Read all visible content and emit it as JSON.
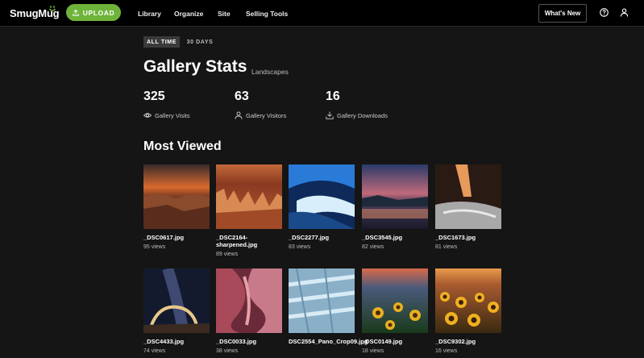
{
  "header": {
    "logo": "SmugMug",
    "upload_label": "UPLOAD",
    "nav": [
      "Library",
      "Organize",
      "Site",
      "Selling Tools"
    ],
    "whats_new": "What's New",
    "accent_color": "#6fb43a"
  },
  "range_tabs": [
    {
      "label": "ALL TIME",
      "active": true
    },
    {
      "label": "30 DAYS",
      "active": false
    }
  ],
  "page": {
    "title": "Gallery Stats",
    "gallery_name": "Landscapes"
  },
  "stats": [
    {
      "value": "325",
      "label": "Gallery Visits",
      "icon": "eye-icon"
    },
    {
      "value": "63",
      "label": "Gallery Visitors",
      "icon": "person-icon"
    },
    {
      "value": "16",
      "label": "Gallery Downloads",
      "icon": "download-icon"
    }
  ],
  "most_viewed": {
    "title": "Most Viewed",
    "items": [
      {
        "file": "_DSC0617.jpg",
        "views": "95 views"
      },
      {
        "file": "_DSC2164-sharpened.jpg",
        "views": "89 views"
      },
      {
        "file": "_DSC2277.jpg",
        "views": "83 views"
      },
      {
        "file": "_DSC3545.jpg",
        "views": "82 views"
      },
      {
        "file": "_DSC1673.jpg",
        "views": "81 views"
      },
      {
        "file": "_DSC4433.jpg",
        "views": "74 views"
      },
      {
        "file": "_DSC0033.jpg",
        "views": "38 views"
      },
      {
        "file": "DSC2554_Pano_Crop09.jpg",
        "views": ""
      },
      {
        "file": "_DSC0149.jpg",
        "views": "18 views"
      },
      {
        "file": "_DSC9302.jpg",
        "views": "16 views"
      }
    ]
  }
}
